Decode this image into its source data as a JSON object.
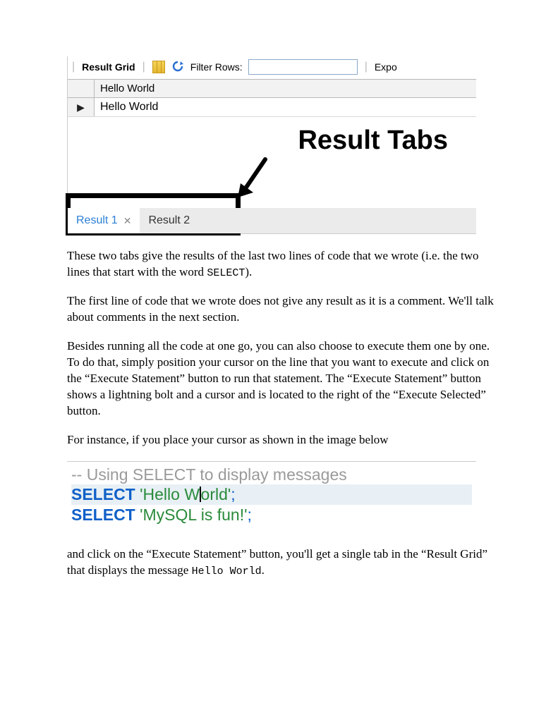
{
  "shot1": {
    "toolbar": {
      "result_grid_label": "Result Grid",
      "filter_label": "Filter Rows:",
      "filter_value": "",
      "export_label": "Expo"
    },
    "column_header": "Hello World",
    "row_value": "Hello World",
    "annotation": "Result Tabs",
    "tabs": {
      "tab1": "Result 1",
      "tab2": "Result 2"
    }
  },
  "para1": "These two tabs give the results of the last two lines of code that we wrote (i.e. the two lines that start with the word ",
  "para1_code": "SELECT",
  "para1_end": ").",
  "para2": "The first line of code that we wrote does not give any result as it is a comment. We'll talk about comments in the next section.",
  "para3": "Besides running all the code at one go, you can also choose to execute them one by one. To do that, simply position your cursor on the line that you want to execute and click on the “Execute Statement” button to run that statement. The “Execute Statement” button shows a lightning bolt and a cursor and is located to the right of the “Execute Selected” button.",
  "para4": "For instance, if you place your cursor as shown in the image below",
  "shot2": {
    "comment": "-- Using SELECT to display messages",
    "line1_kw": "SELECT",
    "line1_str_a": "'Hello W",
    "line1_str_b": "orld'",
    "line1_semi": ";",
    "line2_kw": "SELECT",
    "line2_str": "'MySQL is fun!'",
    "line2_semi": ";"
  },
  "para5_a": "and click on the “Execute Statement” button, you'll get a single tab in the “Result Grid” that displays the message ",
  "para5_code": "Hello World",
  "para5_b": "."
}
